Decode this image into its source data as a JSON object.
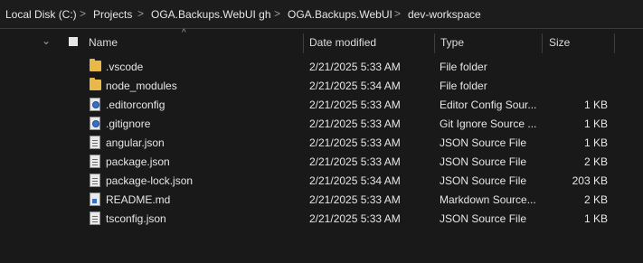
{
  "breadcrumb": {
    "items": [
      "Local Disk (C:)",
      "Projects",
      "OGA.Backups.WebUI gh",
      "OGA.Backups.WebUI",
      "dev-workspace"
    ],
    "separator": ">"
  },
  "columns": {
    "name": "Name",
    "date": "Date modified",
    "type": "Type",
    "size": "Size"
  },
  "files": [
    {
      "name": ".vscode",
      "date": "2/21/2025 5:33 AM",
      "type": "File folder",
      "size": "",
      "icon": "folder-icon"
    },
    {
      "name": "node_modules",
      "date": "2/21/2025 5:34 AM",
      "type": "File folder",
      "size": "",
      "icon": "folder-icon"
    },
    {
      "name": ".editorconfig",
      "date": "2/21/2025 5:33 AM",
      "type": "Editor Config Sour...",
      "size": "1 KB",
      "icon": "settings-file-icon"
    },
    {
      "name": ".gitignore",
      "date": "2/21/2025 5:33 AM",
      "type": "Git Ignore Source ...",
      "size": "1 KB",
      "icon": "settings-file-icon"
    },
    {
      "name": "angular.json",
      "date": "2/21/2025 5:33 AM",
      "type": "JSON Source File",
      "size": "1 KB",
      "icon": "json-file-icon"
    },
    {
      "name": "package.json",
      "date": "2/21/2025 5:33 AM",
      "type": "JSON Source File",
      "size": "2 KB",
      "icon": "json-file-icon"
    },
    {
      "name": "package-lock.json",
      "date": "2/21/2025 5:34 AM",
      "type": "JSON Source File",
      "size": "203 KB",
      "icon": "json-file-icon"
    },
    {
      "name": "README.md",
      "date": "2/21/2025 5:33 AM",
      "type": "Markdown Source...",
      "size": "2 KB",
      "icon": "markdown-file-icon"
    },
    {
      "name": "tsconfig.json",
      "date": "2/21/2025 5:33 AM",
      "type": "JSON Source File",
      "size": "1 KB",
      "icon": "json-file-icon"
    }
  ]
}
